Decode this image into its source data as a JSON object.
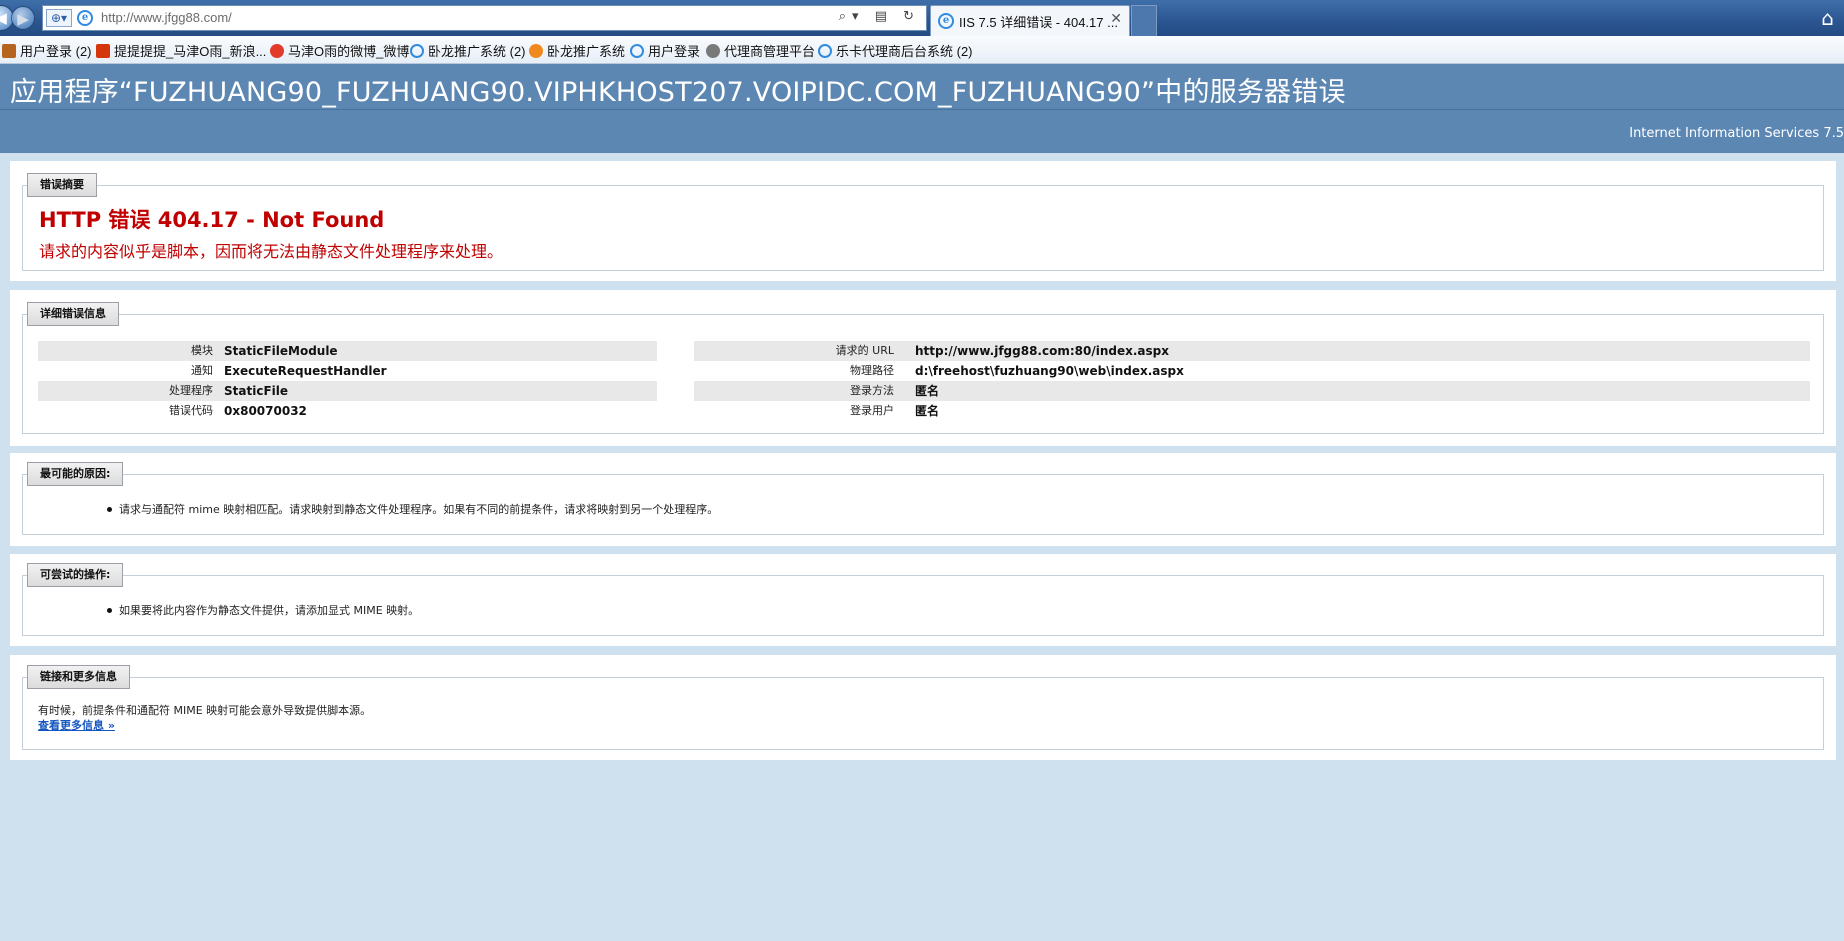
{
  "browser": {
    "address_url": "http://www.jfgg88.com/",
    "tab_title": "IIS 7.5 详细错误 - 404.17 ...",
    "favorites": [
      {
        "label": "用户登录 (2)",
        "color": "#b5651d"
      },
      {
        "label": "提提提提_马津O雨_新浪...",
        "color": "#d4350a"
      },
      {
        "label": "马津O雨的微博_微博",
        "color": "#e23b2c"
      },
      {
        "label": "卧龙推广系统 (2)",
        "color": "#2f8be0"
      },
      {
        "label": "卧龙推广系统",
        "color": "#f08a1e"
      },
      {
        "label": "用户登录",
        "color": "#2f8be0"
      },
      {
        "label": "代理商管理平台",
        "color": "#7a7a7a"
      },
      {
        "label": "乐卡代理商后台系统 (2)",
        "color": "#2f8be0"
      }
    ]
  },
  "page": {
    "header_title": "应用程序“FUZHUANG90_FUZHUANG90.VIPHKHOST207.VOIPIDC.COM_FUZHUANG90”中的服务器错误",
    "server_label": "Internet Information Services 7.5",
    "summary": {
      "legend": "错误摘要",
      "title": "HTTP 错误 404.17 - Not Found",
      "description": "请求的内容似乎是脚本，因而将无法由静态文件处理程序来处理。"
    },
    "detail": {
      "legend": "详细错误信息",
      "left": [
        {
          "key": "模块",
          "value": "StaticFileModule"
        },
        {
          "key": "通知",
          "value": "ExecuteRequestHandler"
        },
        {
          "key": "处理程序",
          "value": "StaticFile"
        },
        {
          "key": "错误代码",
          "value": "0x80070032"
        }
      ],
      "right": [
        {
          "key": "请求的 URL",
          "value": "http://www.jfgg88.com:80/index.aspx"
        },
        {
          "key": "物理路径",
          "value": "d:\\freehost\\fuzhuang90\\web\\index.aspx"
        },
        {
          "key": "登录方法",
          "value": "匿名"
        },
        {
          "key": "登录用户",
          "value": "匿名"
        }
      ]
    },
    "causes": {
      "legend": "最可能的原因:",
      "items": [
        "请求与通配符 mime 映射相匹配。请求映射到静态文件处理程序。如果有不同的前提条件，请求将映射到另一个处理程序。"
      ]
    },
    "actions": {
      "legend": "可尝试的操作:",
      "items": [
        "如果要将此内容作为静态文件提供，请添加显式 MIME 映射。"
      ]
    },
    "more": {
      "legend": "链接和更多信息",
      "text": "有时候，前提条件和通配符 MIME 映射可能会意外导致提供脚本源。",
      "link": "查看更多信息 »"
    }
  }
}
